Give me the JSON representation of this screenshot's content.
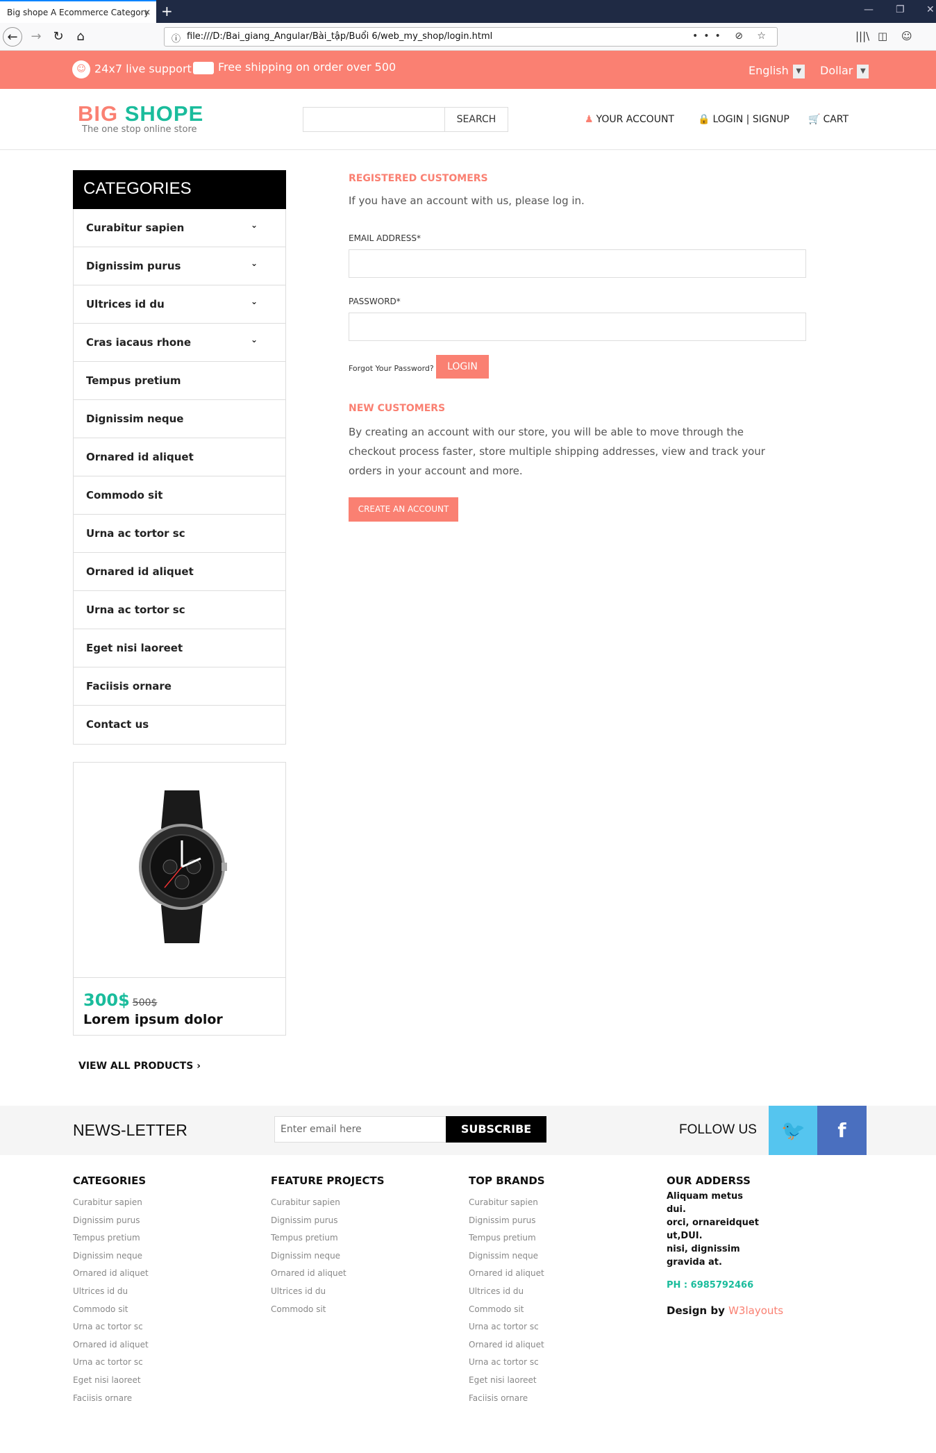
{
  "browser": {
    "tab_title": "Big shope A Ecommerce Category",
    "tab_close": "✕",
    "new_tab": "+",
    "url": "file:///D:/Bai_giang_Angular/Bài_tập/Buổi 6/web_my_shop/login.html",
    "url_tools": "••• ⊘ ☆",
    "win_min": "—",
    "win_restore": "❐",
    "win_close": "✕",
    "back_icon": "←",
    "forward_icon": "→",
    "reload_icon": "↻",
    "home_icon": "⌂",
    "info_icon": "ⓘ",
    "library_icon": "|||\\",
    "sidebar_icon": "◫",
    "account_icon": "☺"
  },
  "topbar": {
    "support_icon": "☺",
    "support": "24x7 live support",
    "shipping": "Free shipping on order over 500",
    "language": "English",
    "currency": "Dollar",
    "dropdown_arrow": "▼"
  },
  "header": {
    "logo_a": "BIG",
    "logo_b": " SHOPE",
    "tagline": "The one stop online store",
    "search_button": "SEARCH",
    "account_icon": "♟",
    "account": "YOUR ACCOUNT",
    "login_icon": "🔒",
    "login": "LOGIN | SIGNUP",
    "cart_icon": "🛒",
    "cart": "CART"
  },
  "sidebar": {
    "title": "CATEGORIES",
    "chevron": "⌄",
    "items": [
      {
        "label": "Curabitur sapien"
      },
      {
        "label": "Dignissim purus"
      },
      {
        "label": "Ultrices id du"
      },
      {
        "label": "Cras iacaus rhone"
      },
      {
        "label": "Tempus pretium"
      },
      {
        "label": "Dignissim neque"
      },
      {
        "label": "Ornared id aliquet"
      },
      {
        "label": "Commodo sit"
      },
      {
        "label": "Urna ac tortor sc"
      },
      {
        "label": "Ornared id aliquet"
      },
      {
        "label": "Urna ac tortor sc"
      },
      {
        "label": "Eget nisi laoreet"
      },
      {
        "label": "Faciisis ornare"
      },
      {
        "label": "Contact us"
      }
    ],
    "product": {
      "price": "300$",
      "old_price": "500$",
      "name": "Lorem ipsum dolor"
    },
    "view_all": "VIEW ALL PRODUCTS  ›"
  },
  "main": {
    "registered_title": "REGISTERED CUSTOMERS",
    "registered_text": "If you have an account with us, please log in.",
    "email_label": "EMAIL ADDRESS*",
    "password_label": "PASSWORD*",
    "forgot": "Forgot Your Password?",
    "login_button": "LOGIN",
    "new_title": "NEW CUSTOMERS",
    "new_text": "By creating an account with our store, you will be able to move through the checkout process faster, store multiple shipping addresses, view and track your orders in your account and more.",
    "create_button": "CREATE AN ACCOUNT"
  },
  "newsletter": {
    "title": "NEWS-LETTER",
    "placeholder": "Enter email here",
    "button": "SUBSCRIBE",
    "follow": "FOLLOW US",
    "twitter_icon": "🐦",
    "facebook_icon": "f"
  },
  "footer": {
    "categories": {
      "title": "CATEGORIES",
      "items": [
        "Curabitur sapien",
        "Dignissim purus",
        "Tempus pretium",
        "Dignissim neque",
        "Ornared id aliquet",
        "Ultrices id du",
        "Commodo sit",
        "Urna ac tortor sc",
        "Ornared id aliquet",
        "Urna ac tortor sc",
        "Eget nisi laoreet",
        "Faciisis ornare"
      ]
    },
    "features": {
      "title": "FEATURE PROJECTS",
      "items": [
        "Curabitur sapien",
        "Dignissim purus",
        "Tempus pretium",
        "Dignissim neque",
        "Ornared id aliquet",
        "Ultrices id du",
        "Commodo sit"
      ]
    },
    "brands": {
      "title": "TOP BRANDS",
      "items": [
        "Curabitur sapien",
        "Dignissim purus",
        "Tempus pretium",
        "Dignissim neque",
        "Ornared id aliquet",
        "Ultrices id du",
        "Commodo sit",
        "Urna ac tortor sc",
        "Ornared id aliquet",
        "Urna ac tortor sc",
        "Eget nisi laoreet",
        "Faciisis ornare"
      ]
    },
    "address": {
      "title": "OUR ADDERSS",
      "lines": [
        "Aliquam metus dui.",
        "orci, ornareidquet",
        "ut,DUI.",
        "nisi, dignissim",
        "gravida at."
      ],
      "phone": "PH : 6985792466",
      "design_by": "Design by ",
      "design_link": "W3layouts"
    }
  }
}
